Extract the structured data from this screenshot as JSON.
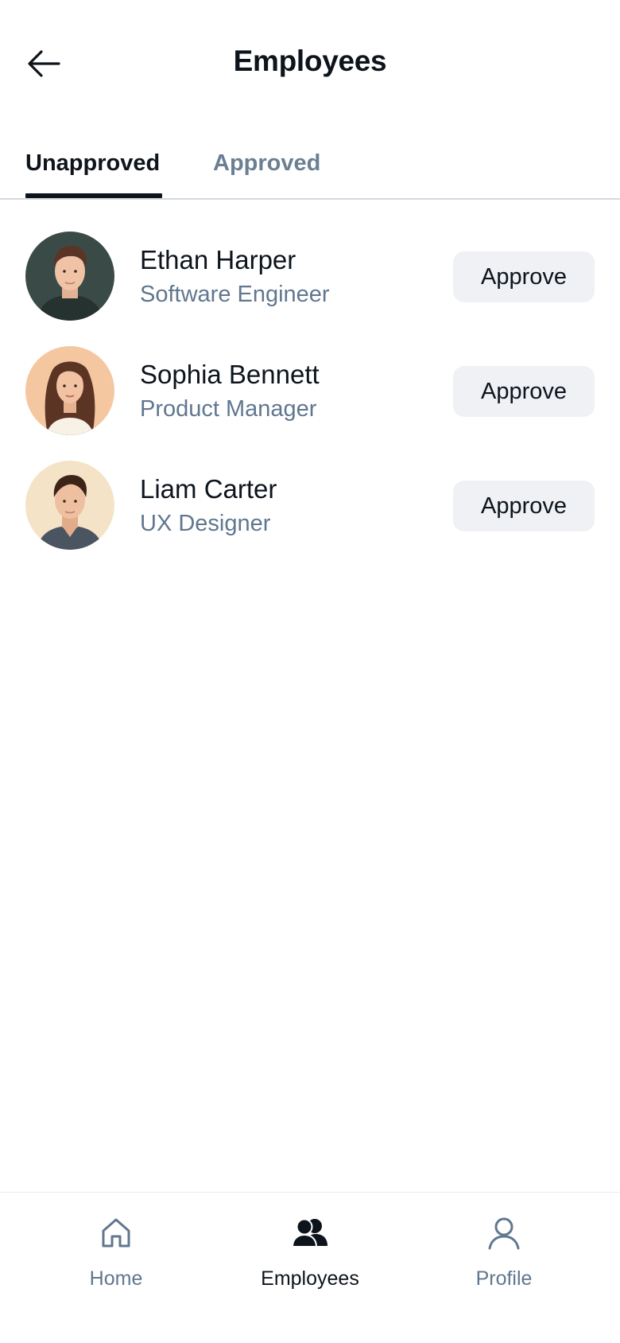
{
  "header": {
    "title": "Employees",
    "back_icon": "arrow-left-icon"
  },
  "tabs": [
    {
      "label": "Unapproved",
      "active": true
    },
    {
      "label": "Approved",
      "active": false
    }
  ],
  "employees": [
    {
      "name": "Ethan Harper",
      "role": "Software Engineer",
      "action": "Approve",
      "avatar_bg": "#3a4a47"
    },
    {
      "name": "Sophia Bennett",
      "role": "Product Manager",
      "action": "Approve",
      "avatar_bg": "#f4c7a1"
    },
    {
      "name": "Liam Carter",
      "role": "UX Designer",
      "action": "Approve",
      "avatar_bg": "#f5e3c8"
    }
  ],
  "bottom_nav": [
    {
      "label": "Home",
      "icon": "home-icon",
      "active": false
    },
    {
      "label": "Employees",
      "icon": "people-icon",
      "active": true
    },
    {
      "label": "Profile",
      "icon": "person-icon",
      "active": false
    }
  ],
  "colors": {
    "text_primary": "#0d141c",
    "text_secondary": "#60778f",
    "button_bg": "#eff1f5",
    "divider": "#d3d9e0"
  }
}
